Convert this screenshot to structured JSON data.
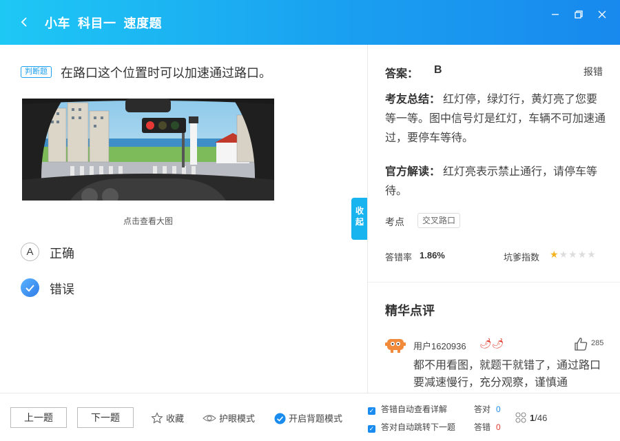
{
  "titlebar": {
    "title": "小车  科目一  速度题",
    "back_icon": "chevron-left-icon",
    "minimize_icon": "minimize-icon",
    "restore_icon": "restore-icon",
    "close_icon": "close-icon"
  },
  "question": {
    "type_badge": "判断题",
    "text": "在路口这个位置时可以加速通过路口。",
    "image_caption": "点击查看大图",
    "options": [
      {
        "letter": "A",
        "text": "正确",
        "selected": false
      },
      {
        "letter": "✓",
        "text": "错误",
        "selected": true
      }
    ]
  },
  "collapse_tab": "收起",
  "answer": {
    "label": "答案：",
    "value": "B",
    "report": "报错",
    "summary_label": "考友总结：",
    "summary_text": "红灯停，绿灯行，黄灯亮了您要等一等。图中信号灯是红灯，车辆不可加速通过，要停车等待。",
    "official_label": "官方解读：",
    "official_text": "红灯亮表示禁止通行，请停车等待。",
    "keypoint_label": "考点",
    "keypoint_tag": "交叉路口",
    "error_rate_label": "答错率",
    "error_rate_value": "1.86%",
    "pit_label": "坑爹指数",
    "pit_stars": 1,
    "pit_max": 5
  },
  "comments": {
    "title": "精华点评",
    "items": [
      {
        "user": "用户1620936",
        "likes": "285",
        "text": "都不用看图，就题干就错了，通过路口要减速慢行，充分观察，谨慎通"
      }
    ]
  },
  "bottom": {
    "prev": "上一题",
    "next": "下一题",
    "favorite": "收藏",
    "eye_mode": "护眼模式",
    "memorize_mode": "开启背题模式",
    "auto_detail": "答错自动查看详解",
    "auto_next": "答对自动跳转下一题",
    "correct_label": "答对",
    "correct_count": "0",
    "wrong_label": "答错",
    "wrong_count": "0",
    "page_current": "1",
    "page_total": "/46"
  },
  "colors": {
    "accent": "#1aa0f0",
    "header_start": "#1ec8f5",
    "header_end": "#1889ee",
    "star": "#f5b21b",
    "wrong": "#e53935"
  }
}
